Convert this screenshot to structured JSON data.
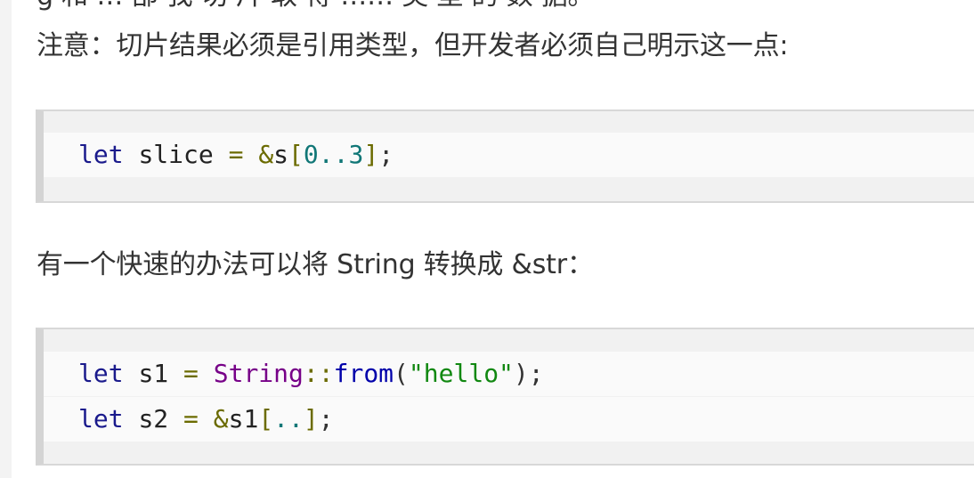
{
  "paragraphs": {
    "cut_top": "g 和 … 部 我 切 片 取 得 …… 类 型 的 数 据。",
    "note": "注意：切片结果必须是引用类型，但开发者必须自己明示这一点:",
    "tip": "有一个快速的办法可以将 String 转换成 &str："
  },
  "code_block_1": {
    "line1": {
      "kw": "let",
      "var": "slice",
      "eq": "=",
      "amp": "&",
      "ident": "s",
      "lb": "[",
      "n1": "0",
      "range": "..",
      "n2": "3",
      "rb": "]",
      "semi": ";"
    }
  },
  "code_block_2": {
    "line1": {
      "kw": "let",
      "var": "s1",
      "eq": "=",
      "type": "String",
      "path": "::",
      "fn": "from",
      "lp": "(",
      "str": "\"hello\"",
      "rp": ")",
      "semi": ";"
    },
    "line2": {
      "kw": "let",
      "var": "s2",
      "eq": "=",
      "amp": "&",
      "ident": "s1",
      "lb": "[",
      "range": "..",
      "rb": "]",
      "semi": ";"
    }
  },
  "colors": {
    "keyword": "#1a1a8c",
    "operator": "#6b6b00",
    "number": "#117777",
    "type": "#770088",
    "function": "#0000aa",
    "string": "#118811",
    "code_bg": "#f1f1f1",
    "code_line_bg": "#fafafa",
    "code_border": "#d4d4d4"
  }
}
